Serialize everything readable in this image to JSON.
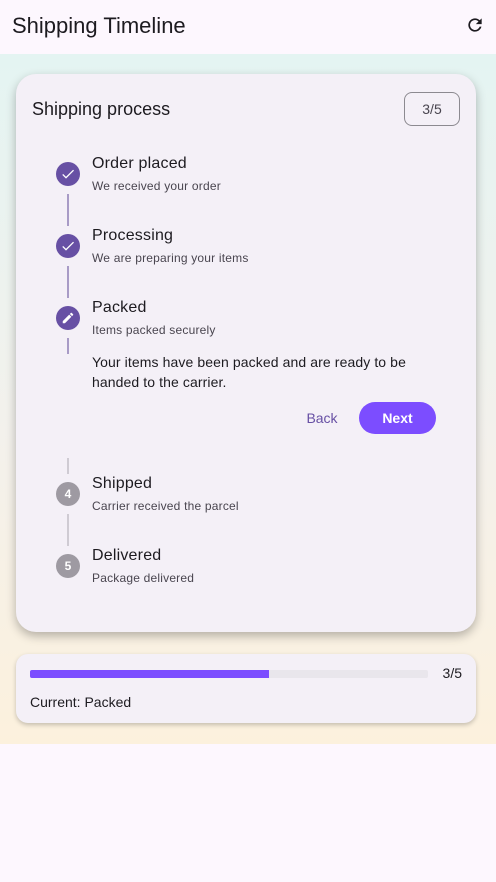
{
  "appbar": {
    "title": "Shipping Timeline",
    "refresh_icon": "refresh-icon"
  },
  "card": {
    "title": "Shipping process",
    "counter": "3/5"
  },
  "steps": [
    {
      "title": "Order placed",
      "subtitle": "We received your order",
      "status": "completed",
      "icon": "check-icon"
    },
    {
      "title": "Processing",
      "subtitle": "We are preparing your items",
      "status": "completed",
      "icon": "check-icon"
    },
    {
      "title": "Packed",
      "subtitle": "Items packed securely",
      "status": "active",
      "icon": "edit-icon",
      "detail": "Your items have been packed and are ready to be handed to the carrier."
    },
    {
      "title": "Shipped",
      "subtitle": "Carrier received the parcel",
      "status": "pending",
      "number": "4"
    },
    {
      "title": "Delivered",
      "subtitle": "Package delivered",
      "status": "pending",
      "number": "5"
    }
  ],
  "controls": {
    "back_label": "Back",
    "next_label": "Next"
  },
  "progress": {
    "fraction": 0.6,
    "label": "3/5",
    "current": "Current: Packed"
  },
  "colors": {
    "primary": "#6750a4",
    "accent": "#7c4dff",
    "pending": "#9e9aa2",
    "card": "#f4f0f7"
  }
}
